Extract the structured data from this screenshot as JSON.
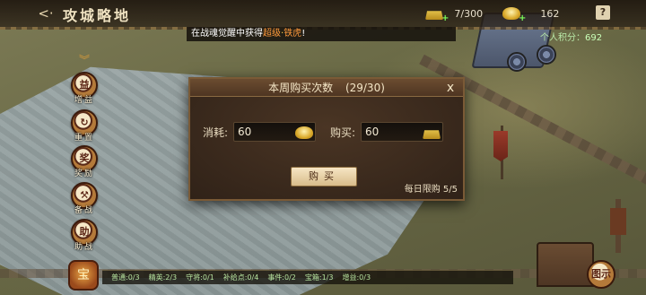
{
  "header": {
    "title": "攻城略地",
    "back_label": "<·",
    "resources": [
      {
        "icon": "gold-bars-icon",
        "value": "7/300"
      },
      {
        "icon": "gold-ingot-icon",
        "value": "162"
      }
    ],
    "help_label": "?"
  },
  "score": {
    "label": "个人积分：",
    "value": "692"
  },
  "notice": {
    "prefix": "在战魂觉醒中获得",
    "highlight1": "超级",
    "sep": "·",
    "highlight2": "铁虎",
    "suffix": "!"
  },
  "side_menu": {
    "collapse_icon": "chevron-down-icon",
    "items": [
      {
        "label": "增益",
        "glyph": "益"
      },
      {
        "label": "重置",
        "glyph": "↻"
      },
      {
        "label": "奖励",
        "glyph": "奖"
      },
      {
        "label": "备战",
        "glyph": "⚒"
      },
      {
        "label": "助战",
        "glyph": "助"
      }
    ],
    "treasure_glyph": "宝"
  },
  "stats": [
    {
      "label": "普通:0/3"
    },
    {
      "label": "精英:2/3"
    },
    {
      "label": "守将:0/1"
    },
    {
      "label": "补给点:0/4"
    },
    {
      "label": "事件:0/2"
    },
    {
      "label": "宝箱:1/3"
    },
    {
      "label": "增益:0/3"
    }
  ],
  "map_button": {
    "label": "图示"
  },
  "dialog": {
    "title": "本周购买次数",
    "count": "(29/30)",
    "close_label": "x",
    "cost_label": "消耗:",
    "cost_value": "60",
    "buy_label": "购买:",
    "buy_value": "60",
    "button_label": "购买",
    "daily_limit": "每日限购 5/5"
  },
  "colors": {
    "accent_gold": "#d9a92a",
    "dialog_bg": "#2e2118",
    "highlight_orange": "#ff9a3c",
    "score_green": "#c9ffb8"
  }
}
